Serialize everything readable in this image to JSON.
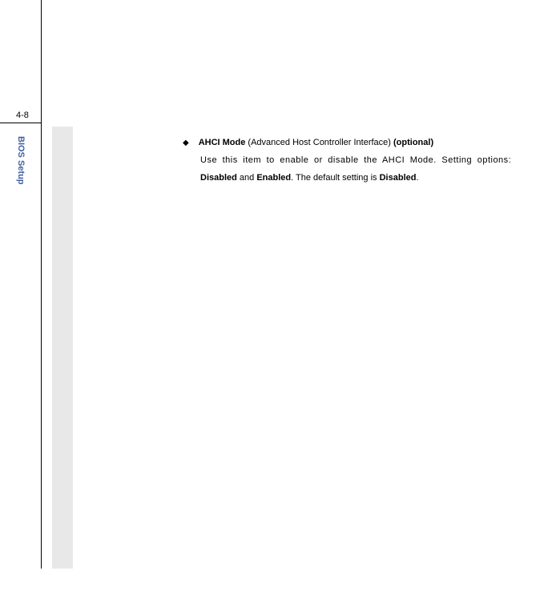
{
  "page_number": "4-8",
  "sidebar_label": "BIOS Setup",
  "content": {
    "title_bold1": "AHCI Mode",
    "title_regular": " (Advanced Host Controller Interface) ",
    "title_bold2": "(optional)",
    "line1_part1": "Use this item to enable or disable the AHCI Mode.  Setting options:",
    "line2_bold1": "Disabled",
    "line2_mid": " and ",
    "line2_bold2": "Enabled",
    "line2_after": ".    The default setting is ",
    "line2_bold3": "Disabled",
    "line2_end": "."
  }
}
